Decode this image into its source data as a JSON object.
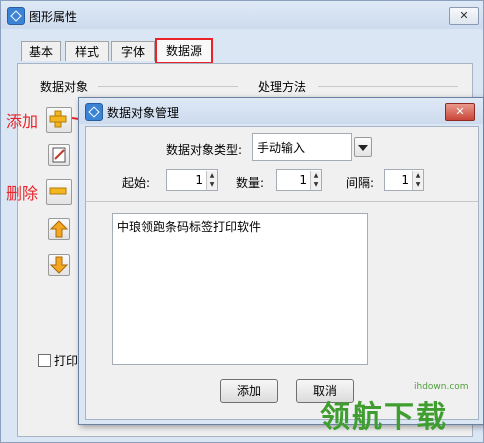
{
  "main_window": {
    "title": "图形属性",
    "close_label": "✕",
    "tabs": [
      {
        "label": "基本"
      },
      {
        "label": "样式"
      },
      {
        "label": "字体"
      },
      {
        "label": "数据源"
      }
    ],
    "group_data_objects": "数据对象",
    "group_processing": "处理方法",
    "print_checkbox_label": "打印"
  },
  "annotations": {
    "add": "添加",
    "delete": "删除"
  },
  "dialog": {
    "title": "数据对象管理",
    "close_label": "✕",
    "type_label": "数据对象类型:",
    "type_value": "手动输入",
    "start_label": "起始:",
    "start_value": "1",
    "count_label": "数量:",
    "count_value": "1",
    "interval_label": "间隔:",
    "interval_value": "1",
    "content_text": "中琅领跑条码标签打印软件",
    "add_button": "添加",
    "cancel_button": "取消"
  },
  "watermark": {
    "url": "ihdown.com",
    "text": "领航下载"
  },
  "colors": {
    "highlight_red": "#e8232a",
    "window_bg": "#dbe6f4",
    "panel_bg": "#f0f0f0"
  }
}
